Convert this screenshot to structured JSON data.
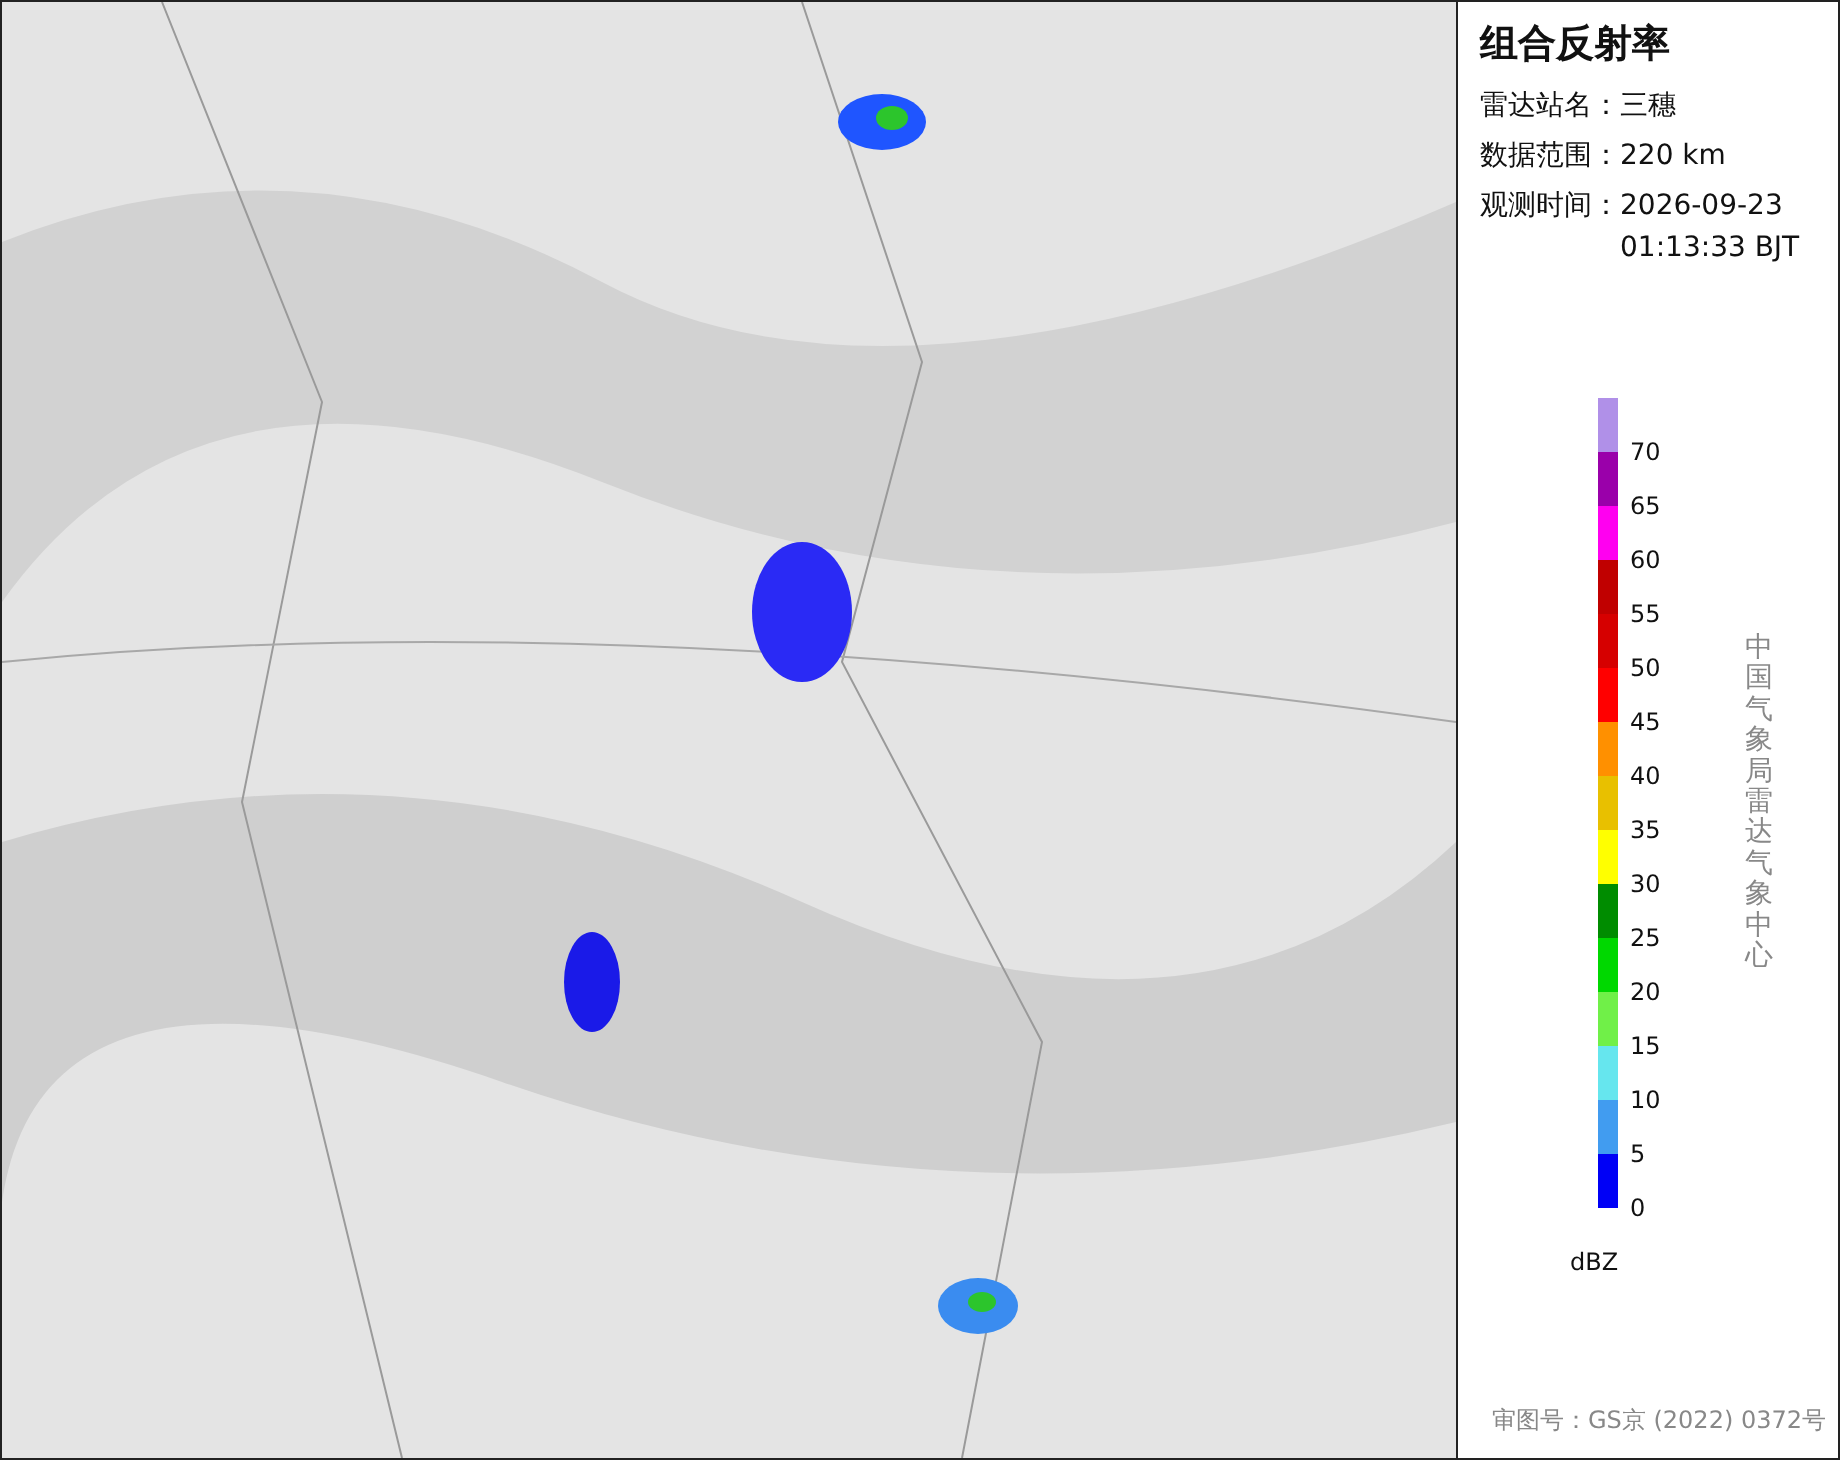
{
  "panel": {
    "title": "组合反射率",
    "fields": [
      {
        "label": "雷达站名：",
        "value": "三穗"
      },
      {
        "label": "数据范围：",
        "value": "220 km"
      },
      {
        "label": "观测时间：",
        "value": "2026-09-23 01:13:33 BJT"
      }
    ],
    "legend": {
      "items": [
        {
          "label": "70",
          "color": "#b090e8"
        },
        {
          "label": "65",
          "color": "#9a00aa"
        },
        {
          "label": "60",
          "color": "#ff00f0"
        },
        {
          "label": "55",
          "color": "#c00000"
        },
        {
          "label": "50",
          "color": "#d60000"
        },
        {
          "label": "45",
          "color": "#ff0000"
        },
        {
          "label": "40",
          "color": "#ff9000"
        },
        {
          "label": "35",
          "color": "#e8c000"
        },
        {
          "label": "30",
          "color": "#ffff00"
        },
        {
          "label": "25",
          "color": "#008c00"
        },
        {
          "label": "20",
          "color": "#00d800"
        },
        {
          "label": "15",
          "color": "#70f048"
        },
        {
          "label": "10",
          "color": "#66e6ee"
        },
        {
          "label": "5",
          "color": "#419cf0"
        },
        {
          "label": "0",
          "color": "#0000f6"
        }
      ],
      "unit": "dBZ"
    },
    "source": "中国气象局雷达气象中心",
    "approval": "审图号：GS京 (2022) 0372号"
  }
}
